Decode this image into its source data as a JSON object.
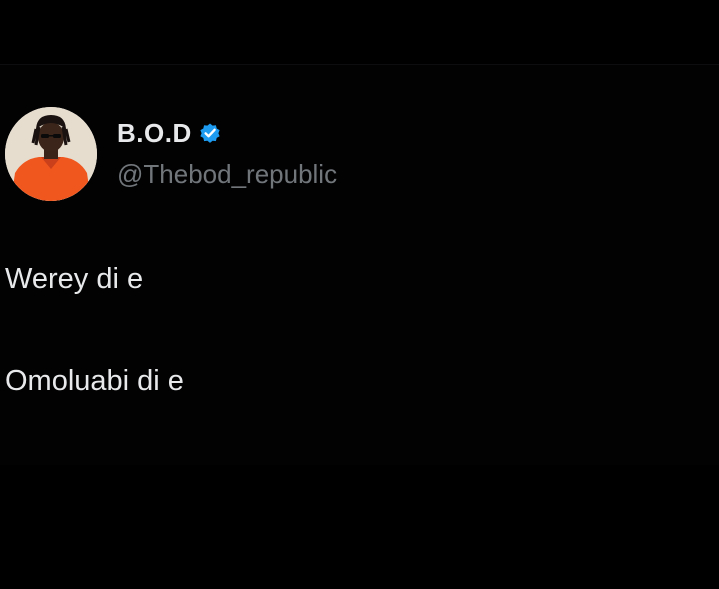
{
  "tweet": {
    "author": {
      "display_name": "B.O.D",
      "handle": "@Thebod_republic",
      "verified": true,
      "verified_icon": "verified-badge-icon",
      "avatar": "profile-avatar"
    },
    "lines": [
      "Werey di e",
      "Omoluabi di e"
    ]
  },
  "colors": {
    "background": "#000000",
    "text_primary": "#e7e9ea",
    "text_secondary": "#71767b",
    "verified_blue": "#1d9bf0",
    "avatar_shirt": "#f0571e"
  }
}
